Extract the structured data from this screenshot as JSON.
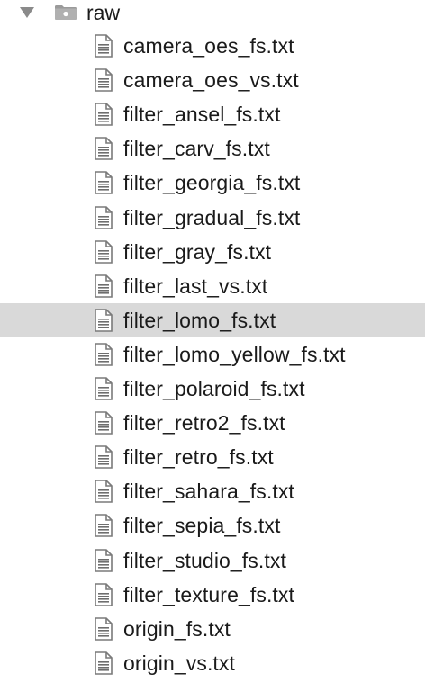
{
  "tree": {
    "folder": {
      "label": "raw",
      "icon": "folder-icon",
      "expanded": true
    },
    "files": [
      {
        "label": "camera_oes_fs.txt",
        "icon": "text-file-icon",
        "selected": false
      },
      {
        "label": "camera_oes_vs.txt",
        "icon": "text-file-icon",
        "selected": false
      },
      {
        "label": "filter_ansel_fs.txt",
        "icon": "text-file-icon",
        "selected": false
      },
      {
        "label": "filter_carv_fs.txt",
        "icon": "text-file-icon",
        "selected": false
      },
      {
        "label": "filter_georgia_fs.txt",
        "icon": "text-file-icon",
        "selected": false
      },
      {
        "label": "filter_gradual_fs.txt",
        "icon": "text-file-icon",
        "selected": false
      },
      {
        "label": "filter_gray_fs.txt",
        "icon": "text-file-icon",
        "selected": false
      },
      {
        "label": "filter_last_vs.txt",
        "icon": "text-file-icon",
        "selected": false
      },
      {
        "label": "filter_lomo_fs.txt",
        "icon": "text-file-icon",
        "selected": true
      },
      {
        "label": "filter_lomo_yellow_fs.txt",
        "icon": "text-file-icon",
        "selected": false
      },
      {
        "label": "filter_polaroid_fs.txt",
        "icon": "text-file-icon",
        "selected": false
      },
      {
        "label": "filter_retro2_fs.txt",
        "icon": "text-file-icon",
        "selected": false
      },
      {
        "label": "filter_retro_fs.txt",
        "icon": "text-file-icon",
        "selected": false
      },
      {
        "label": "filter_sahara_fs.txt",
        "icon": "text-file-icon",
        "selected": false
      },
      {
        "label": "filter_sepia_fs.txt",
        "icon": "text-file-icon",
        "selected": false
      },
      {
        "label": "filter_studio_fs.txt",
        "icon": "text-file-icon",
        "selected": false
      },
      {
        "label": "filter_texture_fs.txt",
        "icon": "text-file-icon",
        "selected": false
      },
      {
        "label": "origin_fs.txt",
        "icon": "text-file-icon",
        "selected": false
      },
      {
        "label": "origin_vs.txt",
        "icon": "text-file-icon",
        "selected": false
      }
    ]
  },
  "colors": {
    "selection": "#d9d9d9",
    "text": "#1a1a1a",
    "icon": "#6e6e6e"
  }
}
